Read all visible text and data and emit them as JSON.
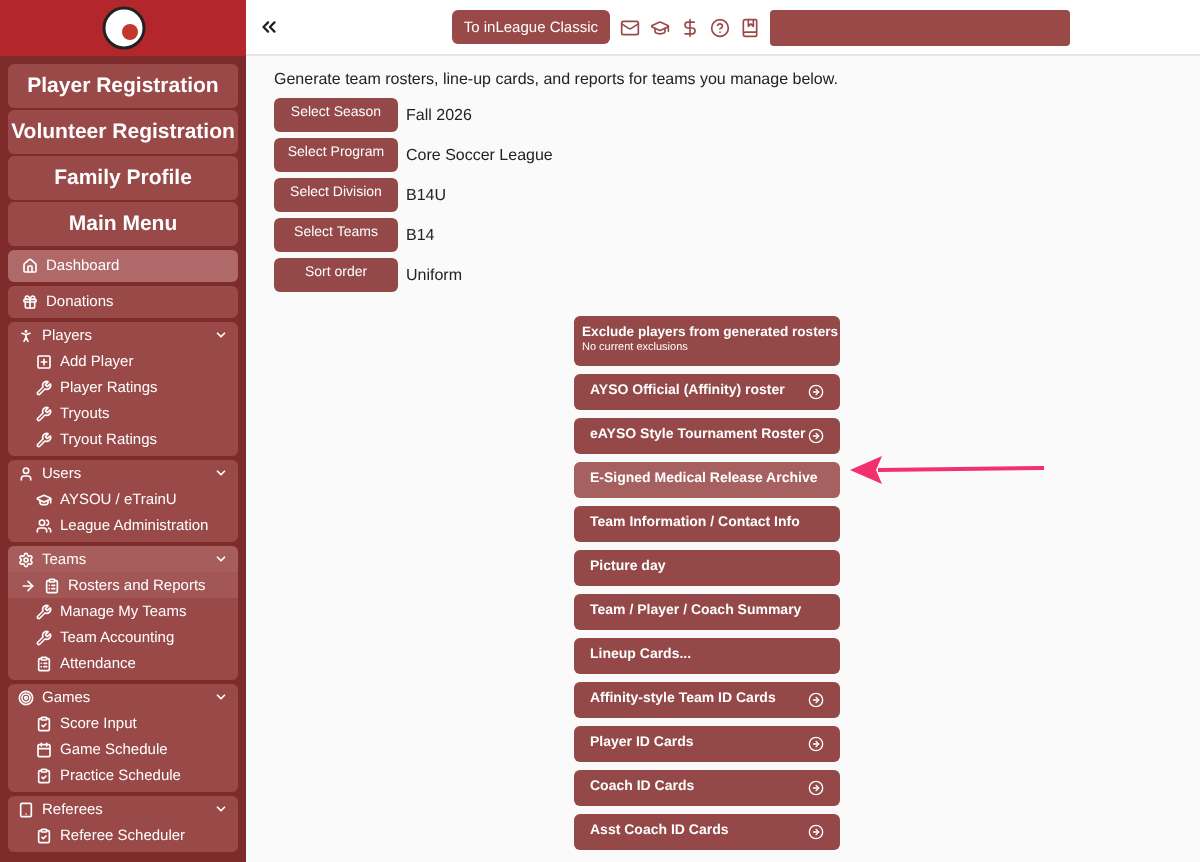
{
  "top_bar": {
    "classic_button": "To inLeague Classic"
  },
  "sidebar": {
    "main_buttons": [
      "Player Registration",
      "Volunteer Registration",
      "Family Profile",
      "Main Menu"
    ],
    "links": [
      {
        "label": "Dashboard",
        "selected": true
      },
      {
        "label": "Donations",
        "selected": false
      }
    ],
    "sections": [
      {
        "label": "Players",
        "selected": false,
        "expanded": true,
        "items": [
          {
            "label": "Add Player",
            "current": false
          },
          {
            "label": "Player Ratings",
            "current": false
          },
          {
            "label": "Tryouts",
            "current": false
          },
          {
            "label": "Tryout Ratings",
            "current": false
          }
        ]
      },
      {
        "label": "Users",
        "selected": false,
        "expanded": true,
        "items": [
          {
            "label": "AYSOU / eTrainU",
            "current": false
          },
          {
            "label": "League Administration",
            "current": false
          }
        ]
      },
      {
        "label": "Teams",
        "selected": true,
        "expanded": true,
        "items": [
          {
            "label": "Rosters and Reports",
            "current": true
          },
          {
            "label": "Manage My Teams",
            "current": false
          },
          {
            "label": "Team Accounting",
            "current": false
          },
          {
            "label": "Attendance",
            "current": false
          }
        ]
      },
      {
        "label": "Games",
        "selected": false,
        "expanded": true,
        "items": [
          {
            "label": "Score Input",
            "current": false
          },
          {
            "label": "Game Schedule",
            "current": false
          },
          {
            "label": "Practice Schedule",
            "current": false
          }
        ]
      },
      {
        "label": "Referees",
        "selected": false,
        "expanded": true,
        "items": [
          {
            "label": "Referee Scheduler",
            "current": false
          }
        ]
      }
    ]
  },
  "intro": "Generate team rosters, line-up cards, and reports for teams you manage below.",
  "filters": [
    {
      "button": "Select Season",
      "value": "Fall 2026"
    },
    {
      "button": "Select Program",
      "value": "Core Soccer League"
    },
    {
      "button": "Select Division",
      "value": "B14U"
    },
    {
      "button": "Select Teams",
      "value": "B14"
    },
    {
      "button": "Sort order",
      "value": "Uniform"
    }
  ],
  "reports": [
    {
      "kind": "two-line",
      "label": "Exclude players from generated rosters",
      "note": "No current exclusions",
      "hovered": false
    },
    {
      "kind": "download",
      "label": "AYSO Official (Affinity) roster",
      "hovered": false
    },
    {
      "kind": "download",
      "label": "eAYSO Style Tournament Roster",
      "hovered": false
    },
    {
      "kind": "plain",
      "label": "E-Signed Medical Release Archive",
      "hovered": true
    },
    {
      "kind": "plain",
      "label": "Team Information / Contact Info",
      "hovered": false
    },
    {
      "kind": "plain",
      "label": "Picture day",
      "hovered": false
    },
    {
      "kind": "plain",
      "label": "Team / Player / Coach Summary",
      "hovered": false
    },
    {
      "kind": "plain",
      "label": "Lineup Cards...",
      "hovered": false
    },
    {
      "kind": "download",
      "label": "Affinity-style Team ID Cards",
      "hovered": false
    },
    {
      "kind": "download",
      "label": "Player ID Cards",
      "hovered": false
    },
    {
      "kind": "download",
      "label": "Coach ID Cards",
      "hovered": false
    },
    {
      "kind": "download",
      "label": "Asst Coach ID Cards",
      "hovered": false
    }
  ]
}
